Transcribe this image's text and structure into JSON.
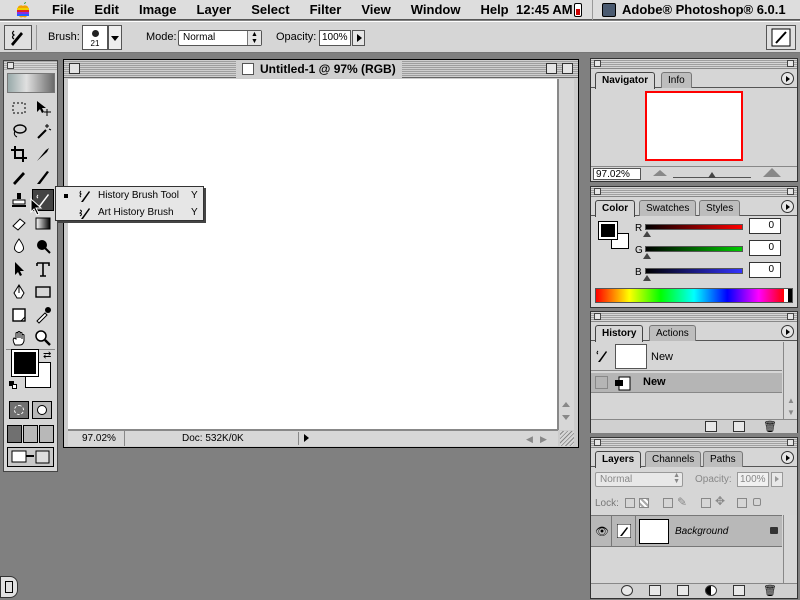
{
  "menubar": {
    "items": [
      "File",
      "Edit",
      "Image",
      "Layer",
      "Select",
      "Filter",
      "View",
      "Window",
      "Help"
    ],
    "clock": "12:45 AM",
    "app_name": "Adobe® Photoshop® 6.0.1"
  },
  "options_bar": {
    "brush_label": "Brush:",
    "brush_size": "21",
    "mode_label": "Mode:",
    "mode_value": "Normal",
    "opacity_label": "Opacity:",
    "opacity_value": "100%"
  },
  "document": {
    "title": "Untitled-1 @ 97% (RGB)",
    "zoom": "97.02%",
    "doc_info": "Doc: 532K/0K"
  },
  "flyout": {
    "items": [
      {
        "label": "History Brush Tool",
        "shortcut": "Y",
        "selected": true
      },
      {
        "label": "Art History Brush",
        "shortcut": "Y",
        "selected": false
      }
    ]
  },
  "navigator": {
    "tabs": [
      "Navigator",
      "Info"
    ],
    "zoom": "97.02%",
    "view_box_color": "#ff0000"
  },
  "color": {
    "tabs": [
      "Color",
      "Swatches",
      "Styles"
    ],
    "channels": [
      {
        "label": "R",
        "value": "0",
        "gradient": "#ff0000"
      },
      {
        "label": "G",
        "value": "0",
        "gradient": "#00cc00"
      },
      {
        "label": "B",
        "value": "0",
        "gradient": "#3333ff"
      }
    ],
    "foreground": "#000000",
    "background": "#ffffff"
  },
  "history": {
    "tabs": [
      "History",
      "Actions"
    ],
    "snapshot_label": "New",
    "state_label": "New"
  },
  "layers": {
    "tabs": [
      "Layers",
      "Channels",
      "Paths"
    ],
    "blend_mode": "Normal",
    "opacity_label": "Opacity:",
    "opacity_value": "100%",
    "lock_label": "Lock:",
    "layer_name": "Background"
  }
}
